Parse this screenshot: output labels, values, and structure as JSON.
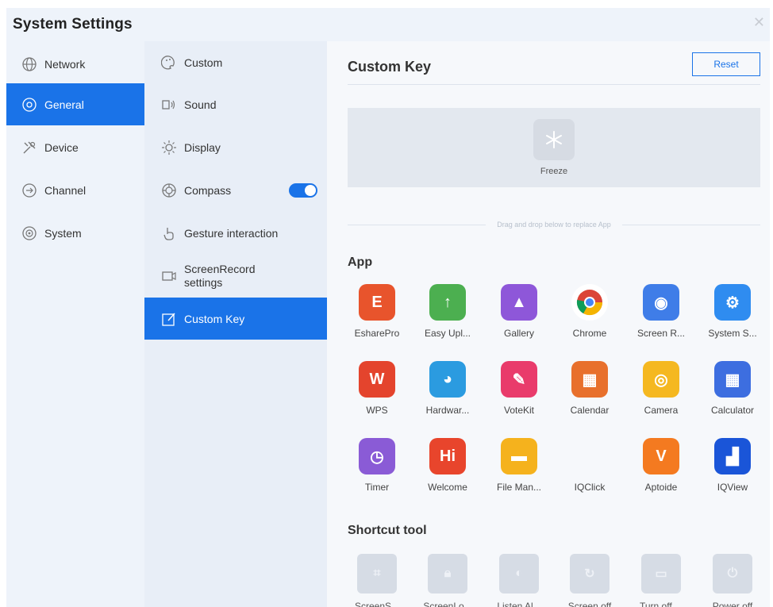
{
  "window": {
    "title": "System Settings",
    "close_icon": "close-icon"
  },
  "sidebar": {
    "items": [
      {
        "label": "Network",
        "icon": "globe-icon"
      },
      {
        "label": "General",
        "icon": "general-icon",
        "active": true
      },
      {
        "label": "Device",
        "icon": "tools-icon"
      },
      {
        "label": "Channel",
        "icon": "channel-icon"
      },
      {
        "label": "System",
        "icon": "system-icon"
      }
    ]
  },
  "subnav": {
    "items": [
      {
        "label": "Custom",
        "icon": "palette-icon"
      },
      {
        "label": "Sound",
        "icon": "speaker-icon"
      },
      {
        "label": "Display",
        "icon": "sun-icon"
      },
      {
        "label": "Compass",
        "icon": "compass-icon",
        "toggle": true
      },
      {
        "label": "Gesture interaction",
        "icon": "hand-icon"
      },
      {
        "label": "ScreenRecord settings",
        "icon": "record-icon"
      },
      {
        "label": "Custom Key",
        "icon": "edit-icon",
        "active": true
      }
    ]
  },
  "main": {
    "title": "Custom Key",
    "reset_label": "Reset",
    "slot": {
      "label": "Freeze",
      "icon": "snowflake-icon"
    },
    "drag_hint": "Drag and drop below to replace App",
    "app_section": "App",
    "apps": [
      {
        "label": "EsharePro",
        "icon": "eshare-icon",
        "glyph": "E",
        "color": "#e8542c"
      },
      {
        "label": "Easy Upl...",
        "icon": "upload-icon",
        "glyph": "↑",
        "color": "#4caf50"
      },
      {
        "label": "Gallery",
        "icon": "gallery-icon",
        "glyph": "▲",
        "color": "#8e57d9"
      },
      {
        "label": "Chrome",
        "icon": "chrome-icon",
        "glyph": "",
        "color": "#ffffff"
      },
      {
        "label": "Screen R...",
        "icon": "screen-record-icon",
        "glyph": "◉",
        "color": "#3f7de8"
      },
      {
        "label": "System S...",
        "icon": "settings-gear-icon",
        "glyph": "⚙",
        "color": "#2f8cf0"
      },
      {
        "label": "WPS",
        "icon": "wps-icon",
        "glyph": "W",
        "color": "#e4442d"
      },
      {
        "label": "Hardwar...",
        "icon": "hardware-icon",
        "glyph": "◕",
        "color": "#2b9be0"
      },
      {
        "label": "VoteKit",
        "icon": "vote-icon",
        "glyph": "✎",
        "color": "#e93b6b"
      },
      {
        "label": "Calendar",
        "icon": "calendar-icon",
        "glyph": "▦",
        "color": "#e8702c"
      },
      {
        "label": "Camera",
        "icon": "camera-icon",
        "glyph": "◎",
        "color": "#f5b820"
      },
      {
        "label": "Calculator",
        "icon": "calculator-icon",
        "glyph": "▦",
        "color": "#3d6ee0"
      },
      {
        "label": "Timer",
        "icon": "timer-icon",
        "glyph": "◷",
        "color": "#8a5bd6"
      },
      {
        "label": "Welcome",
        "icon": "welcome-icon",
        "glyph": "Hi",
        "color": "#e8452c"
      },
      {
        "label": "File Man...",
        "icon": "folder-icon",
        "glyph": "▬",
        "color": "#f5b21d"
      },
      {
        "label": "IQClick",
        "icon": "iqclick-icon",
        "glyph": "",
        "color": "transparent"
      },
      {
        "label": "Aptoide",
        "icon": "aptoide-icon",
        "glyph": "V",
        "color": "#f47a20"
      },
      {
        "label": "IQView",
        "icon": "iqview-icon",
        "glyph": "▟",
        "color": "#1a55d8"
      }
    ],
    "shortcut_section": "Shortcut tool",
    "tools": [
      {
        "label": "ScreenS...",
        "icon": "crop-icon"
      },
      {
        "label": "ScreenLo...",
        "icon": "lock-icon"
      },
      {
        "label": "Listen Al...",
        "icon": "ear-icon"
      },
      {
        "label": "Screen off",
        "icon": "screen-off-icon"
      },
      {
        "label": "Turn off ...",
        "icon": "turn-off-icon"
      },
      {
        "label": "Power off",
        "icon": "power-icon"
      }
    ]
  },
  "colors": {
    "accent": "#1a73e8",
    "sidebar_bg": "#eef3fa",
    "subnav_bg": "#e8eef7",
    "main_bg": "#f6f8fb"
  }
}
